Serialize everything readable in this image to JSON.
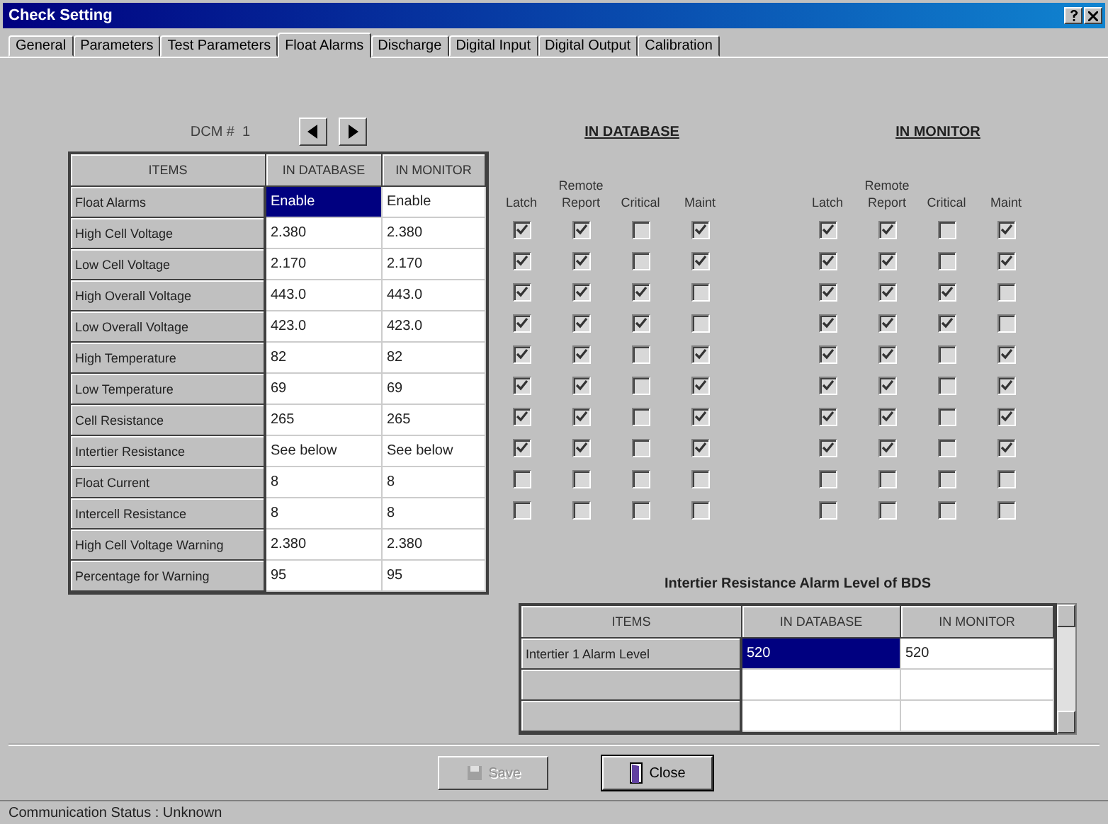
{
  "window": {
    "title": "Check Setting"
  },
  "tabs": [
    {
      "label": "General",
      "selected": false
    },
    {
      "label": "Parameters",
      "selected": false
    },
    {
      "label": "Test Parameters",
      "selected": false
    },
    {
      "label": "Float Alarms",
      "selected": true
    },
    {
      "label": "Discharge",
      "selected": false
    },
    {
      "label": "Digital Input",
      "selected": false
    },
    {
      "label": "Digital Output",
      "selected": false
    },
    {
      "label": "Calibration",
      "selected": false
    }
  ],
  "dcm": {
    "label": "DCM #",
    "value": "1"
  },
  "items_table": {
    "columns": [
      "ITEMS",
      "IN DATABASE",
      "IN MONITOR"
    ],
    "rows": [
      {
        "item": "Float Alarms",
        "database": "Enable",
        "monitor": "Enable",
        "selected": true
      },
      {
        "item": "High Cell Voltage",
        "database": "2.380",
        "monitor": "2.380",
        "selected": false
      },
      {
        "item": "Low Cell Voltage",
        "database": "2.170",
        "monitor": "2.170",
        "selected": false
      },
      {
        "item": "High Overall Voltage",
        "database": "443.0",
        "monitor": "443.0",
        "selected": false
      },
      {
        "item": "Low Overall Voltage",
        "database": "423.0",
        "monitor": "423.0",
        "selected": false
      },
      {
        "item": "High Temperature",
        "database": "82",
        "monitor": "82",
        "selected": false
      },
      {
        "item": "Low Temperature",
        "database": "69",
        "monitor": "69",
        "selected": false
      },
      {
        "item": "Cell Resistance",
        "database": "265",
        "monitor": "265",
        "selected": false
      },
      {
        "item": "Intertier Resistance",
        "database": "See below",
        "monitor": "See below",
        "selected": false
      },
      {
        "item": "Float Current",
        "database": "8",
        "monitor": "8",
        "selected": false
      },
      {
        "item": "Intercell Resistance",
        "database": "8",
        "monitor": "8",
        "selected": false
      },
      {
        "item": "High Cell Voltage Warning",
        "database": "2.380",
        "monitor": "2.380",
        "selected": false
      },
      {
        "item": "Percentage for Warning",
        "database": "95",
        "monitor": "95",
        "selected": false
      }
    ]
  },
  "alarm_groups": [
    {
      "title": "IN DATABASE",
      "columns": [
        "Latch",
        "Remote Report",
        "Critical",
        "Maint"
      ],
      "rows": [
        [
          true,
          true,
          false,
          true
        ],
        [
          true,
          true,
          false,
          true
        ],
        [
          true,
          true,
          true,
          false
        ],
        [
          true,
          true,
          true,
          false
        ],
        [
          true,
          true,
          false,
          true
        ],
        [
          true,
          true,
          false,
          true
        ],
        [
          true,
          true,
          false,
          true
        ],
        [
          true,
          true,
          false,
          true
        ],
        [
          false,
          false,
          false,
          false
        ],
        [
          false,
          false,
          false,
          false
        ]
      ]
    },
    {
      "title": "IN MONITOR",
      "columns": [
        "Latch",
        "Remote Report",
        "Critical",
        "Maint"
      ],
      "rows": [
        [
          true,
          true,
          false,
          true
        ],
        [
          true,
          true,
          false,
          true
        ],
        [
          true,
          true,
          true,
          false
        ],
        [
          true,
          true,
          true,
          false
        ],
        [
          true,
          true,
          false,
          true
        ],
        [
          true,
          true,
          false,
          true
        ],
        [
          true,
          true,
          false,
          true
        ],
        [
          true,
          true,
          false,
          true
        ],
        [
          false,
          false,
          false,
          false
        ],
        [
          false,
          false,
          false,
          false
        ]
      ]
    }
  ],
  "intertier": {
    "title": "Intertier Resistance Alarm Level of BDS",
    "columns": [
      "ITEMS",
      "IN DATABASE",
      "IN MONITOR"
    ],
    "rows": [
      {
        "item": "Intertier 1 Alarm Level",
        "database": "520",
        "monitor": "520",
        "selected": true
      }
    ]
  },
  "buttons": [
    {
      "label": "Save",
      "kind": "save",
      "disabled": true
    },
    {
      "label": "Close",
      "kind": "close",
      "disabled": false
    }
  ],
  "status_bar": "Communication Status : Unknown"
}
